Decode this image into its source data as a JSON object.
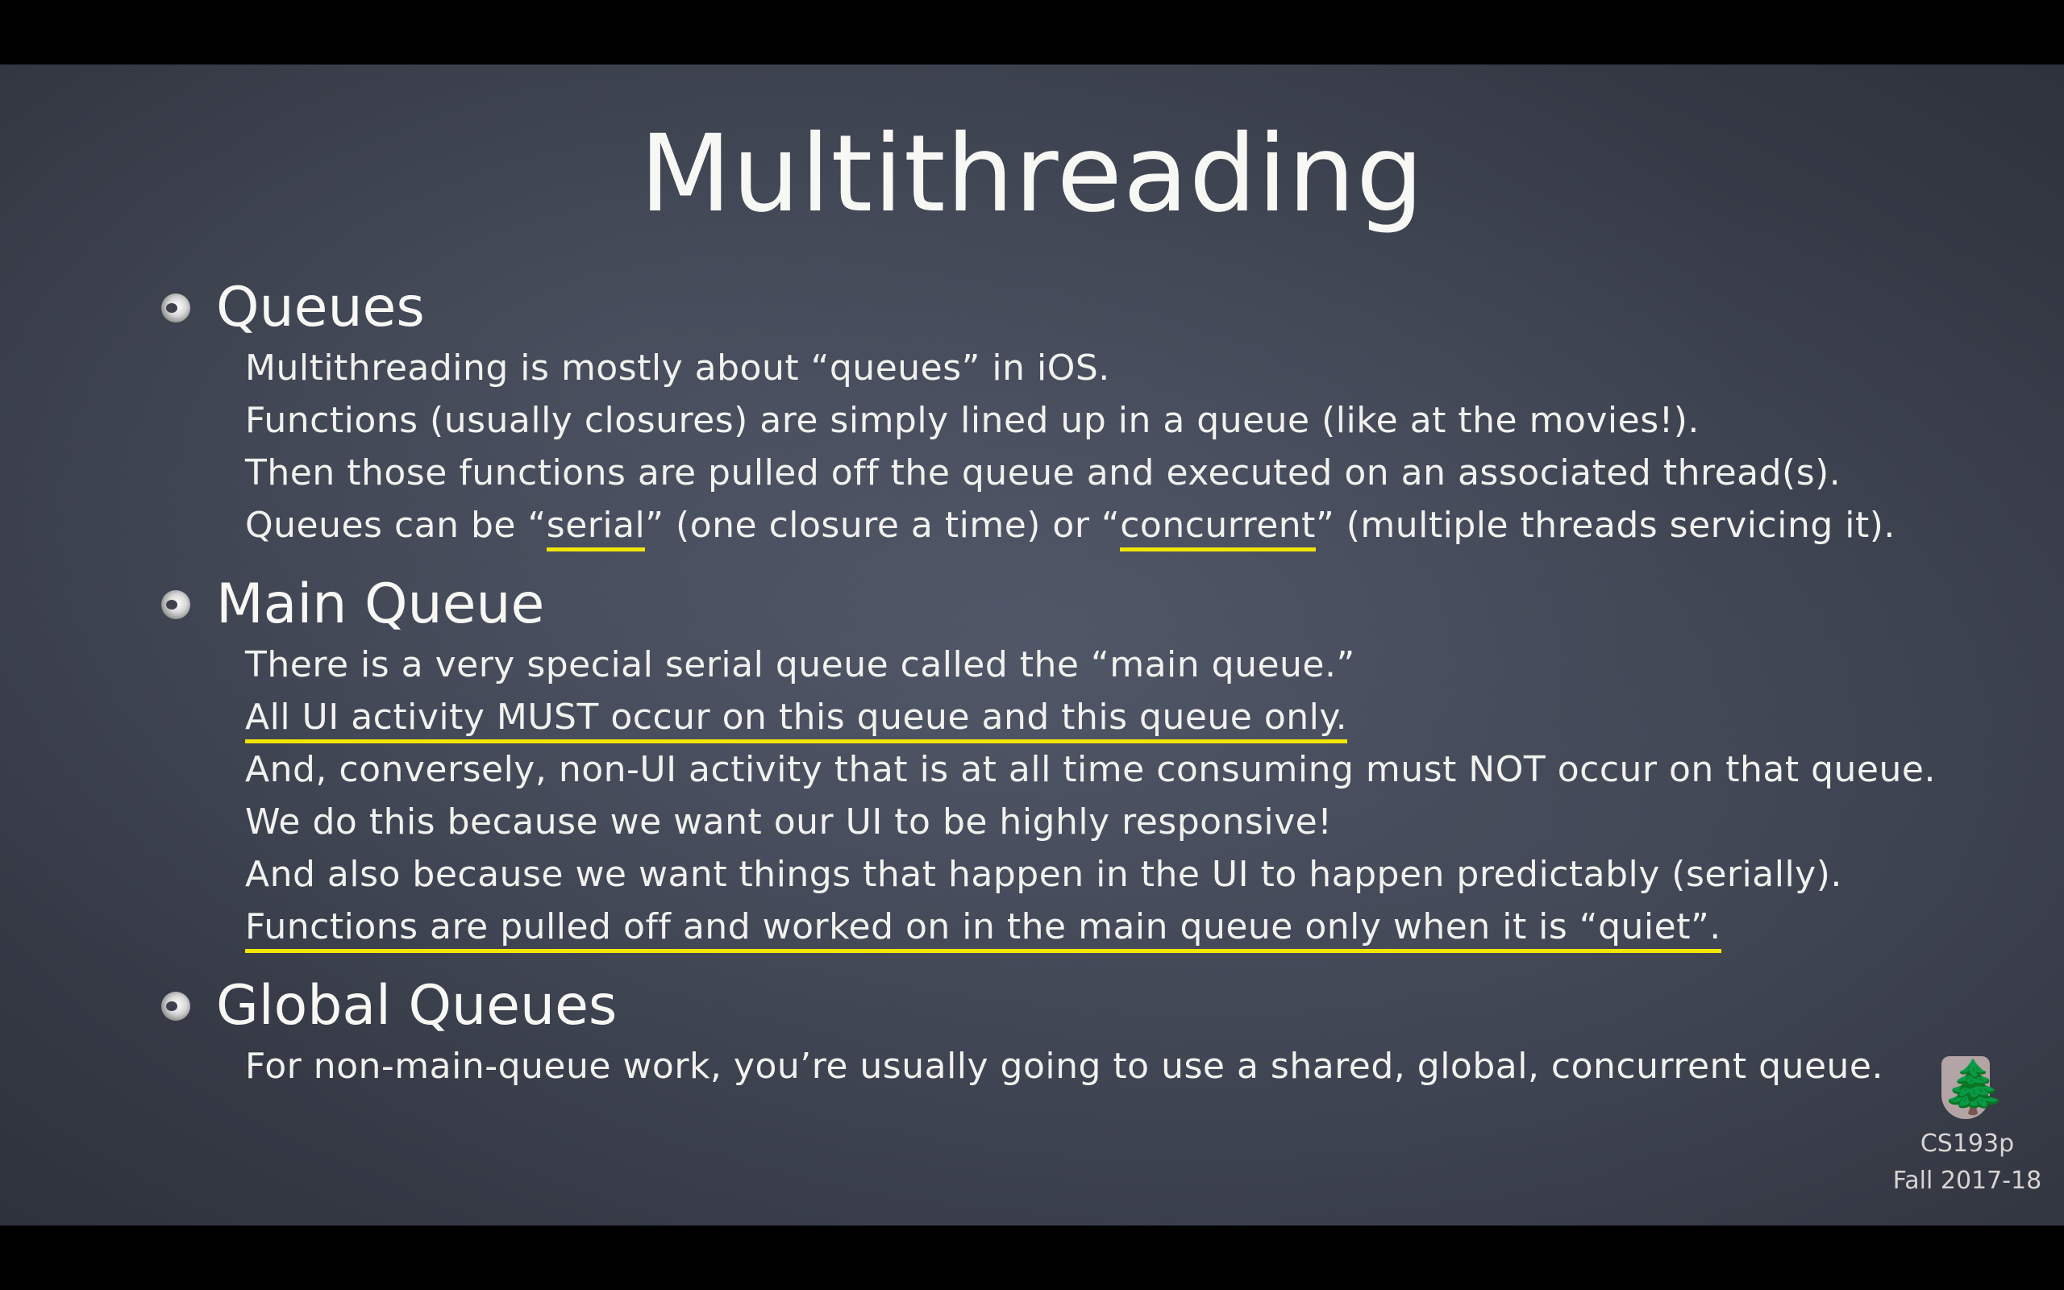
{
  "slide": {
    "title": "Multithreading",
    "sections": [
      {
        "heading": "Queues",
        "lines": [
          {
            "text": "Multithreading is mostly about “queues” in iOS."
          },
          {
            "text": "Functions (usually closures) are simply lined up in a queue (like at the movies!)."
          },
          {
            "text": "Then those functions are pulled off the queue and executed on an associated thread(s)."
          },
          {
            "pre": "Queues can be “",
            "u1": "serial",
            "mid": "” (one closure a time) or “",
            "u2": "concurrent",
            "post": "” (multiple threads servicing it)."
          }
        ]
      },
      {
        "heading": "Main Queue",
        "lines": [
          {
            "text": "There is a very special serial queue called the “main queue.”"
          },
          {
            "text": "All UI activity MUST occur on this queue and this queue only."
          },
          {
            "text": "And, conversely, non-UI activity that is at all time consuming must NOT occur on that queue."
          },
          {
            "text": "We do this because we want our UI to be highly responsive!"
          },
          {
            "text": "And also because we want things that happen in the UI to happen predictably (serially)."
          },
          {
            "text": "Functions are pulled off and worked on in the main queue only when it is “quiet”."
          }
        ]
      },
      {
        "heading": "Global Queues",
        "lines": [
          {
            "text": "For non-main-queue work, you’re usually going to use a shared, global, concurrent queue."
          }
        ]
      }
    ],
    "footer": {
      "logo_icon": "stanford-tree-icon",
      "course": "CS193p",
      "term": "Fall 2017-18"
    }
  },
  "colors": {
    "underline": "#f2e600",
    "text": "#f4f4f0",
    "background": "#3b404d"
  }
}
